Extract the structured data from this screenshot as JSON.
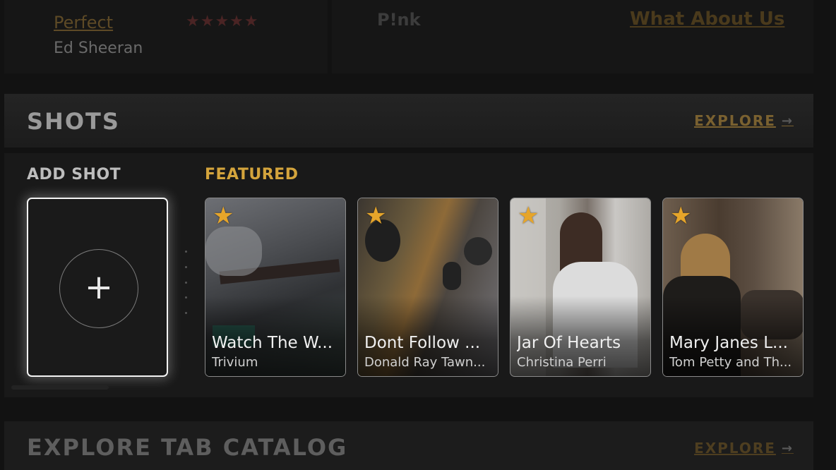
{
  "top_row": {
    "song_title": "Perfect",
    "song_artist": "Ed Sheeran",
    "rating_stars": "★★★★★",
    "artist_2": "P!nk",
    "song_title_2": "What About Us"
  },
  "shots": {
    "title": "SHOTS",
    "explore_label": "EXPLORE",
    "explore_arrow": "→",
    "add_label": "ADD SHOT",
    "add_icon": "+",
    "featured_label": "FEATURED",
    "cards": [
      {
        "title": "Watch The W...",
        "artist": "Trivium",
        "badge": "★"
      },
      {
        "title": "Dont Follow ...",
        "artist": "Donald Ray Tawn...",
        "badge": "★"
      },
      {
        "title": "Jar Of Hearts",
        "artist": "Christina Perri",
        "badge": "★"
      },
      {
        "title": "Mary Janes L...",
        "artist": "Tom Petty and Th...",
        "badge": "★"
      }
    ]
  },
  "catalog": {
    "title": "EXPLORE TAB CATALOG",
    "explore_label": "EXPLORE",
    "explore_arrow": "→"
  },
  "colors": {
    "accent_gold": "#d4a43c",
    "star_gold": "#e6a52a",
    "background": "#121212"
  }
}
